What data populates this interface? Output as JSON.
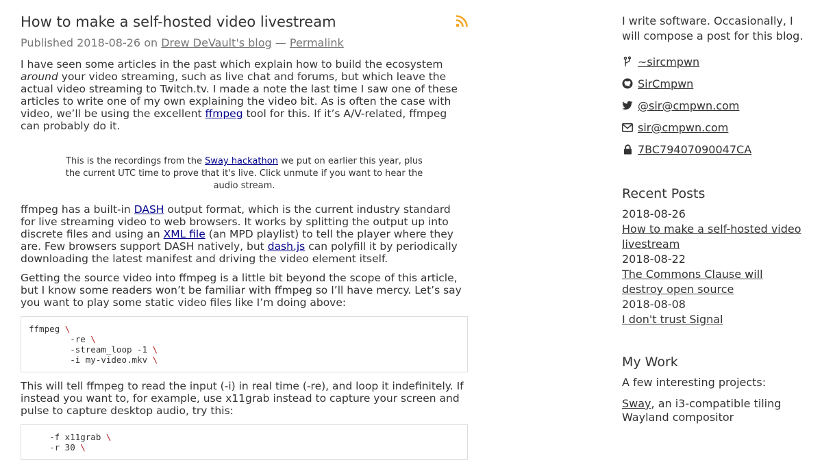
{
  "article": {
    "title": "How to make a self-hosted video livestream",
    "published_prefix": "Published 2018-08-26 on",
    "blog_link": "Drew DeVault's blog",
    "separator": "—",
    "permalink": "Permalink",
    "p1_a": "I have seen some articles in the past which explain how to build the ecosystem",
    "p1_em": "around",
    "p1_b": "your video streaming, such as live chat and forums, but which leave the actual video streaming to Twitch.tv. I made a note the last time I saw one of these articles to write one of my own explaining the video bit. As is often the case with video, we’ll be using the excellent",
    "p1_link": "ffmpeg",
    "p1_c": "tool for this. If it’s A/V-related, ffmpeg can probably do it.",
    "caption_a": "This is the recordings from the",
    "caption_link": "Sway hackathon",
    "caption_b": "we put on earlier this year, plus the current UTC time to prove that it's live. Click unmute if you want to hear the audio stream.",
    "p2_a": "ffmpeg has a built-in",
    "p2_link1": "DASH",
    "p2_b": "output format, which is the current industry standard for live streaming video to web browsers. It works by splitting the output up into discrete files and using an",
    "p2_link2": "XML file",
    "p2_c": "(an MPD playlist) to tell the player where they are. Few browsers support DASH natively, but",
    "p2_link3": "dash.js",
    "p2_d": "can polyfill it by periodically downloading the latest manifest and driving the video element itself.",
    "p3": "Getting the source video into ffmpeg is a little bit beyond the scope of this article, but I know some readers won’t be familiar with ffmpeg so I’ll have mercy. Let’s say you want to play some static video files like I’m doing above:",
    "code1": [
      "ffmpeg",
      "        -re",
      "        -stream_loop -1",
      "        -i my-video.mkv"
    ],
    "code_continuation": "\\",
    "p4": "This will tell ffmpeg to read the input (-i) in real time (-re), and loop it indefinitely. If instead you want to, for example, use x11grab instead to capture your screen and pulse to capture desktop audio, try this:",
    "code2": [
      "    -f x11grab",
      "    -r 30"
    ]
  },
  "sidebar": {
    "about": "I write software. Occasionally, I will compose a post for this blog.",
    "contacts": [
      {
        "icon": "fork-icon",
        "label": "~sircmpwn"
      },
      {
        "icon": "github-icon",
        "label": "SirCmpwn"
      },
      {
        "icon": "twitter-icon",
        "label": "@sir@cmpwn.com"
      },
      {
        "icon": "mail-icon",
        "label": "sir@cmpwn.com"
      },
      {
        "icon": "lock-icon",
        "label": "7BC79407090047CA"
      }
    ],
    "recent_heading": "Recent Posts",
    "posts": [
      {
        "date": "2018-08-26",
        "title": "How to make a self-hosted video livestream"
      },
      {
        "date": "2018-08-22",
        "title": "The Commons Clause will destroy open source"
      },
      {
        "date": "2018-08-08",
        "title": "I don't trust Signal"
      }
    ],
    "work_heading": "My Work",
    "work_intro": "A few interesting projects:",
    "work_item_link": "Sway",
    "work_item_text": ", an i3-compatible tiling Wayland compositor"
  },
  "colors": {
    "link": "#00008b",
    "rss": "#f5a623",
    "code_backslash": "#b22222"
  }
}
